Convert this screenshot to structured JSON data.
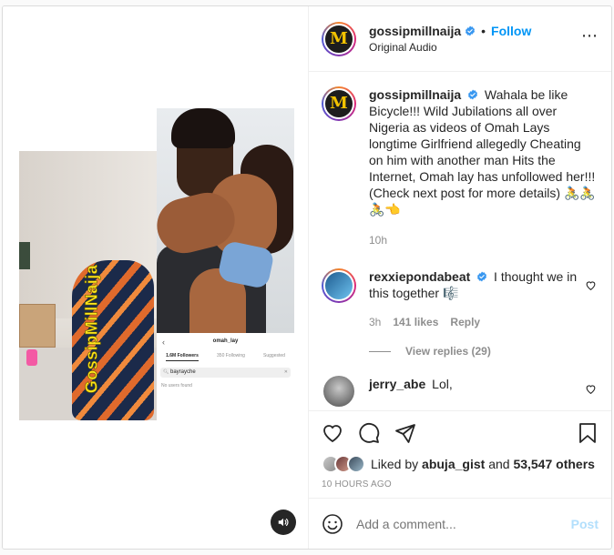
{
  "post": {
    "media": {
      "watermark": "GossipMillNaija",
      "screenshot": {
        "username": "omah_lay",
        "tabs": [
          "1.6M Followers",
          "350 Following",
          "Suggested"
        ],
        "search_value": "bayrayche",
        "empty_message": "No users found"
      }
    },
    "header": {
      "username": "gossipmillnaija",
      "dot": "•",
      "follow_label": "Follow",
      "subtitle": "Original Audio",
      "more_icon": "⋯",
      "avatar_letter": "M"
    },
    "caption": {
      "username": "gossipmillnaija",
      "text": "Wahala be like Bicycle!!! Wild Jubilations all over Nigeria as videos of Omah Lays longtime Girlfriend allegedly Cheating on him with another man Hits the Internet, Omah lay has unfollowed her!!! (Check next post for more details) 🚴🚴🚴👈",
      "time": "10h"
    },
    "comments": [
      {
        "username": "rexxiepondabeat",
        "text": "I thought we in this together 🎼",
        "time": "3h",
        "likes": "141 likes",
        "reply_label": "Reply",
        "view_replies": "View replies (29)"
      },
      {
        "username": "jerry_abe",
        "text": "Lol,"
      }
    ],
    "likes": {
      "prefix": "Liked by",
      "user": "abuja_gist",
      "joiner": "and",
      "count": "53,547 others"
    },
    "timestamp": "10 HOURS AGO",
    "add_comment": {
      "placeholder": "Add a comment...",
      "post_label": "Post"
    },
    "colors": {
      "accent": "#0095f6",
      "post_disabled": "#b2dffc",
      "verified": "#3897f0"
    }
  }
}
